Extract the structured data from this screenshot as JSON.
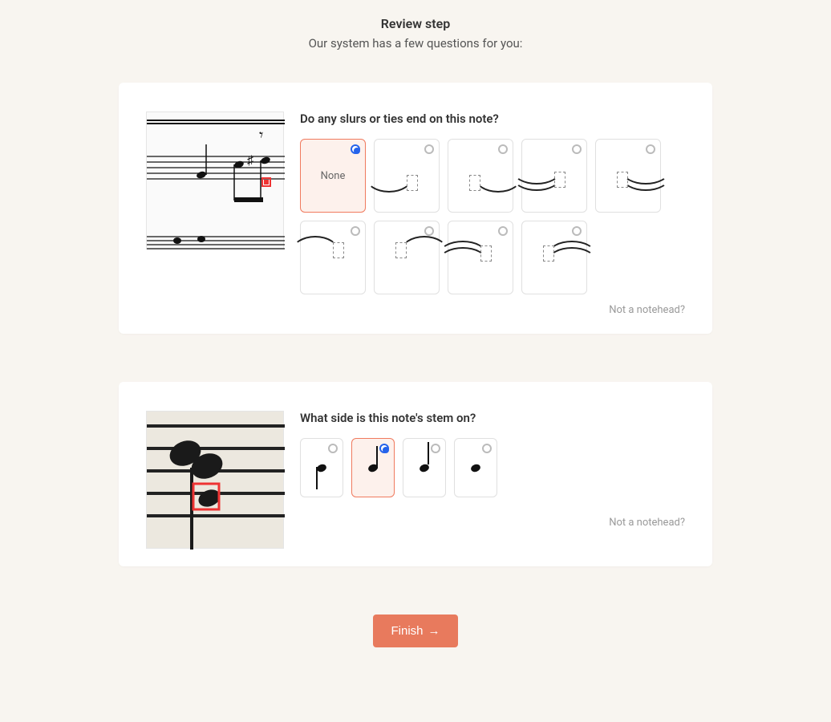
{
  "header": {
    "title": "Review step",
    "subtitle": "Our system has a few questions for you:"
  },
  "card1": {
    "question": "Do any slurs or ties end on this note?",
    "options": [
      {
        "id": "none",
        "label": "None",
        "selected": true
      },
      {
        "id": "slur-1-end",
        "label": "",
        "selected": false
      },
      {
        "id": "slur-1-start",
        "label": "",
        "selected": false
      },
      {
        "id": "slur-2-end",
        "label": "",
        "selected": false
      },
      {
        "id": "slur-2-start",
        "label": "",
        "selected": false
      },
      {
        "id": "slur-1-end-under",
        "label": "",
        "selected": false
      },
      {
        "id": "slur-1-start-under",
        "label": "",
        "selected": false
      },
      {
        "id": "slur-2-end-under",
        "label": "",
        "selected": false
      },
      {
        "id": "slur-2-start-under",
        "label": "",
        "selected": false
      }
    ],
    "not_notehead": "Not a notehead?"
  },
  "card2": {
    "question": "What side is this note's stem on?",
    "options": [
      {
        "id": "stem-right-up",
        "selected": false
      },
      {
        "id": "stem-left-down",
        "selected": true
      },
      {
        "id": "stem-right-up-hollow",
        "selected": false
      },
      {
        "id": "no-stem",
        "selected": false
      }
    ],
    "not_notehead": "Not a notehead?"
  },
  "finish": {
    "label": "Finish"
  }
}
